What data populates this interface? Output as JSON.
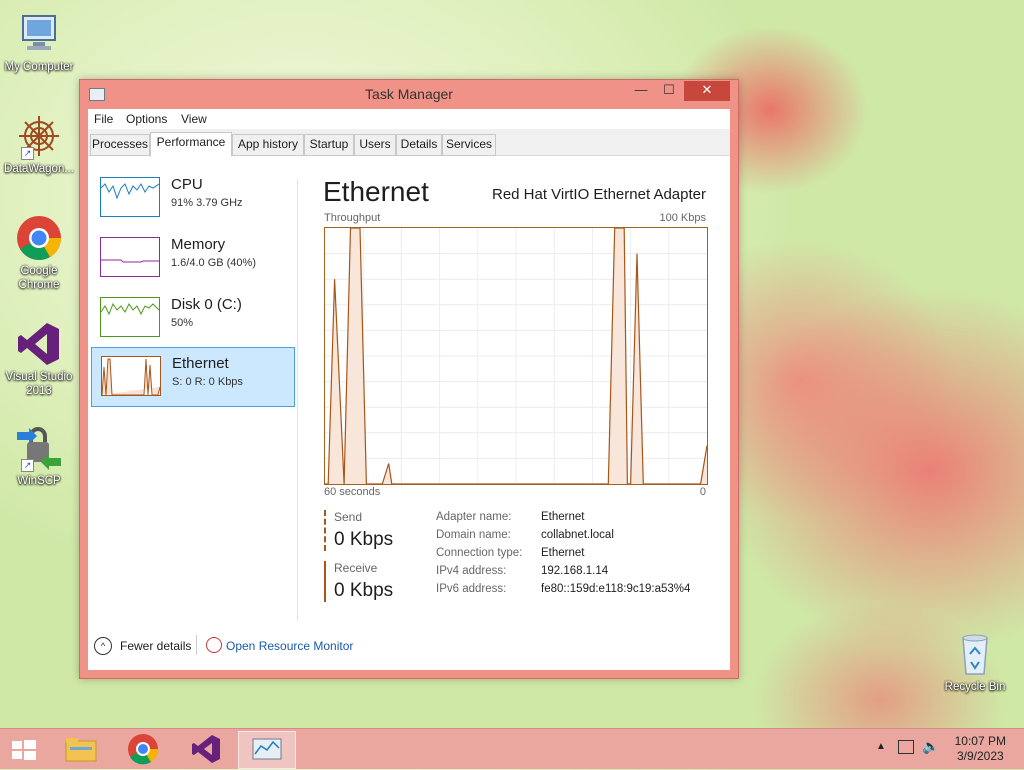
{
  "desktop": {
    "icons": [
      {
        "label": "My Computer"
      },
      {
        "label": "DataWagon..."
      },
      {
        "label": "Google Chrome"
      },
      {
        "label": "Visual Studio 2013"
      },
      {
        "label": "WinSCP"
      },
      {
        "label": "Recycle Bin"
      }
    ]
  },
  "window": {
    "title": "Task Manager",
    "controls": {
      "minimize": "—",
      "maximize": "☐",
      "close": "✕"
    }
  },
  "menu": [
    "File",
    "Options",
    "View"
  ],
  "tabs": [
    {
      "label": "Processes",
      "active": false
    },
    {
      "label": "Performance",
      "active": true
    },
    {
      "label": "App history",
      "active": false
    },
    {
      "label": "Startup",
      "active": false
    },
    {
      "label": "Users",
      "active": false
    },
    {
      "label": "Details",
      "active": false
    },
    {
      "label": "Services",
      "active": false
    }
  ],
  "sidebar": {
    "items": [
      {
        "title": "CPU",
        "subtitle": "91% 3.79 GHz",
        "color": "#1a7fbf"
      },
      {
        "title": "Memory",
        "subtitle": "1.6/4.0 GB (40%)",
        "color": "#8b2a9a"
      },
      {
        "title": "Disk 0 (C:)",
        "subtitle": "50%",
        "color": "#4d9a1a"
      },
      {
        "title": "Ethernet",
        "subtitle": "S: 0 R: 0 Kbps",
        "color": "#a7561a",
        "selected": true
      }
    ]
  },
  "main": {
    "title": "Ethernet",
    "adapter": "Red Hat VirtIO Ethernet Adapter",
    "throughput_label": "Throughput",
    "max_label": "100 Kbps",
    "x_left": "60 seconds",
    "x_right": "0",
    "send_label": "Send",
    "send_value": "0 Kbps",
    "receive_label": "Receive",
    "receive_value": "0 Kbps",
    "details": [
      {
        "key": "Adapter name:",
        "value": "Ethernet"
      },
      {
        "key": "Domain name:",
        "value": "collabnet.local"
      },
      {
        "key": "Connection type:",
        "value": "Ethernet"
      },
      {
        "key": "IPv4 address:",
        "value": "192.168.1.14"
      },
      {
        "key": "IPv6 address:",
        "value": "fe80::159d:e118:9c19:a53%4"
      }
    ]
  },
  "footer": {
    "fewer_details": "Fewer details",
    "resource_monitor": "Open Resource Monitor"
  },
  "chart_data": {
    "type": "line",
    "title": "Throughput",
    "xlabel": "",
    "ylabel": "",
    "x_range": [
      60,
      0
    ],
    "ylim": [
      0,
      100
    ],
    "series": [
      {
        "x": [
          60,
          59.5,
          58.5,
          57,
          56,
          55,
          54.5,
          53.5,
          52.5,
          51,
          50,
          49.5,
          49,
          48,
          46,
          45,
          42,
          41,
          40,
          38,
          30,
          20,
          18,
          17,
          16,
          15.5,
          14.5,
          13,
          12.5,
          12,
          11,
          10,
          9,
          4,
          1,
          0
        ],
        "values": [
          0,
          0,
          80,
          0,
          100,
          100,
          100,
          0,
          0,
          0,
          8,
          0,
          0,
          0,
          0,
          0,
          0,
          0,
          0,
          0,
          0,
          0,
          0,
          0,
          0,
          0,
          100,
          100,
          0,
          0,
          90,
          0,
          0,
          0,
          0,
          15
        ]
      }
    ],
    "grid": true
  },
  "taskbar": {
    "clock_time": "10:07 PM",
    "clock_date": "3/9/2023",
    "accent": "#e9a7a0"
  }
}
